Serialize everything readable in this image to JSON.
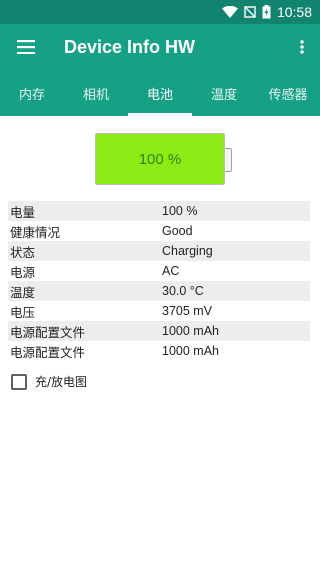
{
  "status_bar": {
    "time": "10:58"
  },
  "app_bar": {
    "title": "Device Info HW"
  },
  "tabs": [
    {
      "label": "内存"
    },
    {
      "label": "相机"
    },
    {
      "label": "电池",
      "active": true
    },
    {
      "label": "温度"
    },
    {
      "label": "传感器"
    }
  ],
  "battery": {
    "level_text": "100 %",
    "level": 1.0
  },
  "info_rows": [
    {
      "label": "电量",
      "value": "100 %"
    },
    {
      "label": "健康情况",
      "value": "Good"
    },
    {
      "label": "状态",
      "value": "Charging"
    },
    {
      "label": "电源",
      "value": "AC"
    },
    {
      "label": "温度",
      "value": "30.0 °C"
    },
    {
      "label": "电压",
      "value": "3705 mV"
    },
    {
      "label": "电源配置文件",
      "value": "1000 mAh"
    },
    {
      "label": "电源配置文件",
      "value": "1000 mAh"
    }
  ],
  "checkbox": {
    "label": "充/放电图",
    "checked": false
  },
  "colors": {
    "primary": "#16a085",
    "status": "#10846f",
    "battery": "#8aec14"
  },
  "icons": [
    "wifi-icon",
    "signal-off-icon",
    "battery-charging-icon",
    "menu-icon",
    "more-vert-icon"
  ]
}
